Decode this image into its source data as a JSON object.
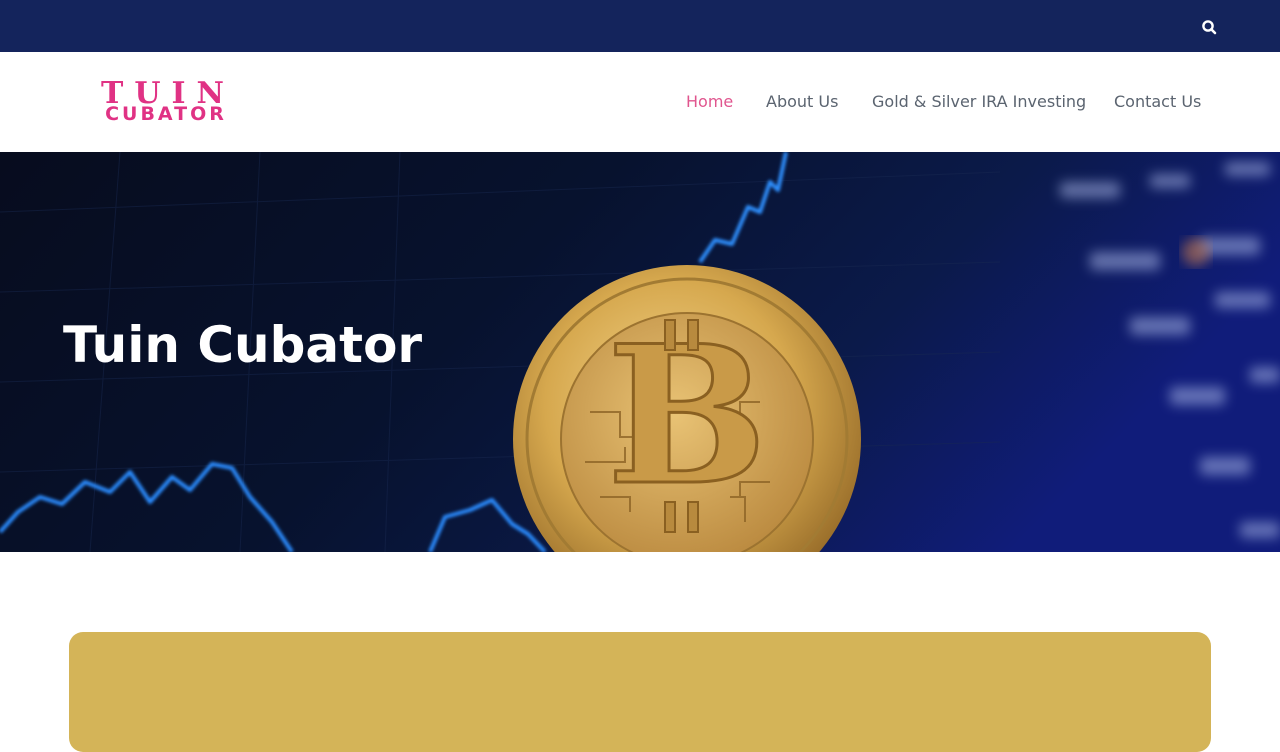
{
  "topbar": {
    "search_icon": "search-icon",
    "background": "#14245c"
  },
  "header": {
    "logo": {
      "line1": "TUIN",
      "line2": "CUBATOR",
      "color": "#e03284"
    },
    "nav": [
      {
        "label": "Home",
        "active": true
      },
      {
        "label": "About Us",
        "active": false
      },
      {
        "label": "Gold & Silver IRA Investing",
        "active": false
      },
      {
        "label": "Contact Us",
        "active": false
      }
    ],
    "active_color": "#e0558e"
  },
  "hero": {
    "title": "Tuin Cubator"
  },
  "content": {
    "card_color": "#d4b458"
  }
}
